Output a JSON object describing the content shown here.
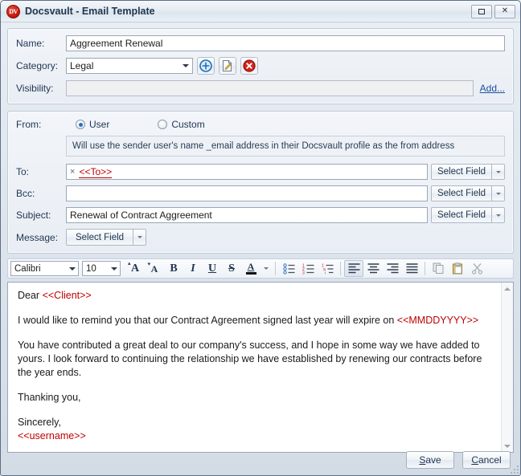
{
  "window": {
    "title": "Docsvault - Email Template",
    "logo_text": "DV",
    "buttons": {
      "maximize": "maximize-restore",
      "close": "✕"
    }
  },
  "form": {
    "name": {
      "label": "Name:",
      "value": "Aggreement Renewal"
    },
    "category": {
      "label": "Category:",
      "value": "Legal",
      "actions": {
        "add": "add-category",
        "edit": "edit-category",
        "delete": "delete-category"
      }
    },
    "visibility": {
      "label": "Visibility:",
      "value": "",
      "add_link": "Add..."
    }
  },
  "email": {
    "from": {
      "label": "From:",
      "options": [
        {
          "label": "User",
          "selected": true
        },
        {
          "label": "Custom",
          "selected": false
        }
      ],
      "info": "Will use the sender user's name _email address in their Docsvault profile as the from address"
    },
    "to": {
      "label": "To:",
      "chip_remove": "×",
      "value": "<<To>>",
      "button": "Select Field"
    },
    "bcc": {
      "label": "Bcc:",
      "value": "",
      "button": "Select Field"
    },
    "subject": {
      "label": "Subject:",
      "value": "Renewal of Contract Aggreement",
      "button": "Select Field"
    },
    "message": {
      "label": "Message:",
      "button": "Select Field"
    }
  },
  "toolbar": {
    "font_family": "Calibri",
    "font_size": "10",
    "buttons": [
      {
        "name": "grow-font-icon",
        "glyph": "A",
        "sup": "▴"
      },
      {
        "name": "shrink-font-icon",
        "glyph": "A",
        "sup": "▾"
      },
      {
        "name": "bold-icon",
        "glyph": "B"
      },
      {
        "name": "italic-icon",
        "glyph": "I"
      },
      {
        "name": "underline-icon",
        "glyph": "U"
      },
      {
        "name": "strikethrough-icon",
        "glyph": "S"
      },
      {
        "name": "font-color-icon",
        "glyph": "A"
      },
      {
        "name": "font-color-dropdown-icon",
        "glyph": "▾"
      },
      {
        "name": "bullet-list-icon",
        "glyph": ""
      },
      {
        "name": "numbered-list-icon",
        "glyph": ""
      },
      {
        "name": "multilevel-list-icon",
        "glyph": ""
      },
      {
        "name": "align-left-icon",
        "glyph": ""
      },
      {
        "name": "align-center-icon",
        "glyph": ""
      },
      {
        "name": "align-right-icon",
        "glyph": ""
      },
      {
        "name": "align-justify-icon",
        "glyph": ""
      },
      {
        "name": "copy-icon",
        "glyph": ""
      },
      {
        "name": "paste-icon",
        "glyph": ""
      },
      {
        "name": "cut-icon",
        "glyph": ""
      }
    ]
  },
  "message_body": {
    "greeting_prefix": "Dear ",
    "greeting_placeholder": "<<Client>>",
    "para1_prefix": "I would like to remind you that our Contract Agreement signed last year will expire on  ",
    "para1_placeholder": "<<MMDDYYYY>>",
    "para2": "You have contributed a great deal to our company's success, and I hope in some way we have added to yours.  I look forward to continuing the relationship we have established by renewing our contracts before the year ends.",
    "para3": "Thanking you,",
    "para4": "Sincerely,",
    "signature_placeholder": "<<username>>"
  },
  "footer": {
    "save": {
      "accel": "S",
      "rest": "ave"
    },
    "cancel": {
      "accel": "C",
      "rest": "ancel"
    }
  },
  "colors": {
    "placeholder_red": "#c00000",
    "link_blue": "#1a4fa0",
    "logo_red": "#c0170c",
    "label_text": "#1f3552"
  }
}
